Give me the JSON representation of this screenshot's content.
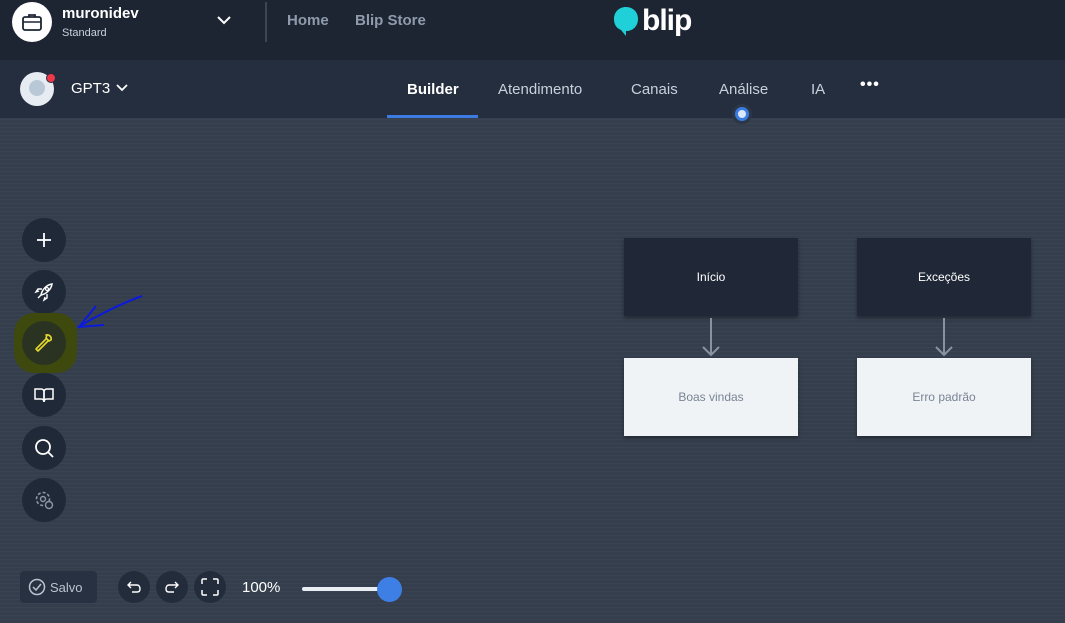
{
  "header": {
    "org_name": "muronidev",
    "org_plan": "Standard",
    "nav": {
      "home": "Home",
      "store": "Blip Store"
    },
    "logo_text": "blip"
  },
  "bot": {
    "name": "GPT3"
  },
  "tabs": [
    {
      "label": "Builder",
      "active": true
    },
    {
      "label": "Atendimento"
    },
    {
      "label": "Canais"
    },
    {
      "label": "Análise"
    },
    {
      "label": "IA"
    }
  ],
  "more_label": "•••",
  "blocks": {
    "inicio": "Início",
    "excecoes": "Exceções",
    "boas_vindas": "Boas vindas",
    "erro_padrao": "Erro padrão"
  },
  "footer": {
    "saved_label": "Salvo",
    "zoom_label": "100%",
    "zoom_value": 1.0
  },
  "colors": {
    "accent": "#3b7be2",
    "topbar": "#1d2533",
    "subbar": "#252e3e",
    "logo": "#1fd0d8",
    "annotation": "#0000ff"
  },
  "icons": [
    "briefcase-icon",
    "chevron-down-icon",
    "plus-icon",
    "rocket-icon",
    "wrench-icon",
    "book-icon",
    "search-icon",
    "gear-icon",
    "undo-icon",
    "redo-icon",
    "fullscreen-icon",
    "check-circle-icon"
  ]
}
